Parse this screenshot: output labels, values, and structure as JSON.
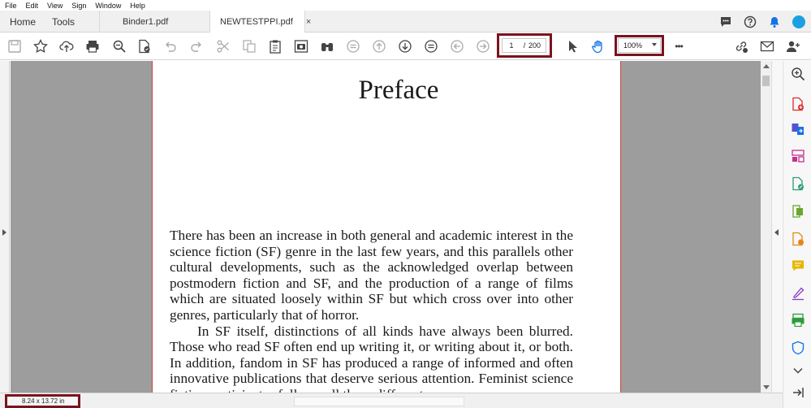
{
  "menubar": {
    "items": [
      "File",
      "Edit",
      "View",
      "Sign",
      "Window",
      "Help"
    ]
  },
  "tabs": {
    "home": "Home",
    "tools": "Tools",
    "doc1": "Binder1.pdf",
    "doc2": "NEWTESTPPI.pdf",
    "close_glyph": "×"
  },
  "toolbar": {
    "page_current": "1",
    "page_separator": "/",
    "page_total": "200",
    "zoom": "100%",
    "more": "•••"
  },
  "icons": {
    "tabbar_right": [
      "chat-icon",
      "help-icon",
      "bell-icon",
      "profile-icon"
    ],
    "toolbar_left": [
      "save-icon",
      "bookmark-star-icon",
      "cloud-upload-icon",
      "print-icon",
      "zoom-search-icon",
      "protect-document-icon",
      "undo-icon",
      "redo-icon",
      "cut-icon",
      "copy-icon",
      "paste-clipboard-icon",
      "snapshot-camera-icon",
      "find-binoculars-icon",
      "page-fit-icon",
      "previous-page-up-icon",
      "next-page-down-icon",
      "read-mode-icon",
      "back-icon",
      "forward-icon"
    ],
    "toolbar_right": [
      "select-cursor-icon",
      "hand-tool-icon",
      "share-link-icon",
      "email-icon",
      "add-user-icon"
    ],
    "right_panel": [
      "zoom-in-icon",
      "create-pdf-icon",
      "combine-files-icon",
      "organize-pages-icon",
      "edit-pdf-icon",
      "export-pdf-icon",
      "scan-ocr-icon",
      "comment-icon",
      "fill-sign-icon",
      "print-production-icon",
      "protect-shield-icon",
      "more-tools-chevron-icon",
      "collapse-panel-icon"
    ]
  },
  "document": {
    "heading": "Preface",
    "paragraphs": [
      "There has been an increase in both general and academic interest in the science fiction (SF) genre in the last few years, and this parallels other cultural developments, such as the acknowledged overlap between postmodern fiction and SF, and the production of a range of films which are situated loosely within SF but which cross over into other genres, particularly that of horror.",
      "In SF itself, distinctions of all kinds have always been blurred. Those who read SF often end up writing it, or writing about it, or both. In addition, fandom in SF has produced a range of informed and often innovative publications that deserve serious attention. Feminist science fiction participates fully on all these different"
    ]
  },
  "statusbar": {
    "dimensions": "8.24 x 13.72 in"
  },
  "colors": {
    "highlight_box": "#7a1320",
    "document_background": "#9d9d9d",
    "accent_blue": "#1473e6"
  }
}
